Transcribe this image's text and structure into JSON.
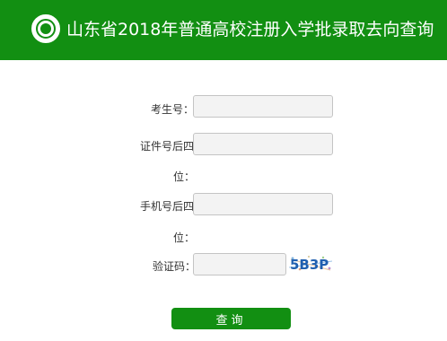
{
  "header": {
    "title": "山东省2018年普通高校注册入学批录取去向查询",
    "logo": "university-emblem-icon"
  },
  "form": {
    "exam_number_label": "考生号：",
    "exam_number_value": "",
    "id_last4_label_line1": "证件号后四",
    "id_last4_label_line2": "位：",
    "id_last4_value": "",
    "phone_last4_label_line1": "手机号后四",
    "phone_last4_label_line2": "位：",
    "phone_last4_value": "",
    "captcha_label": "验证码：",
    "captcha_value": "",
    "captcha_image_text": "5B3P"
  },
  "actions": {
    "query_label": "查询"
  },
  "colors": {
    "brand_green": "#128f12",
    "input_bg": "#f3f3f3",
    "input_border": "#c4c4c4"
  }
}
